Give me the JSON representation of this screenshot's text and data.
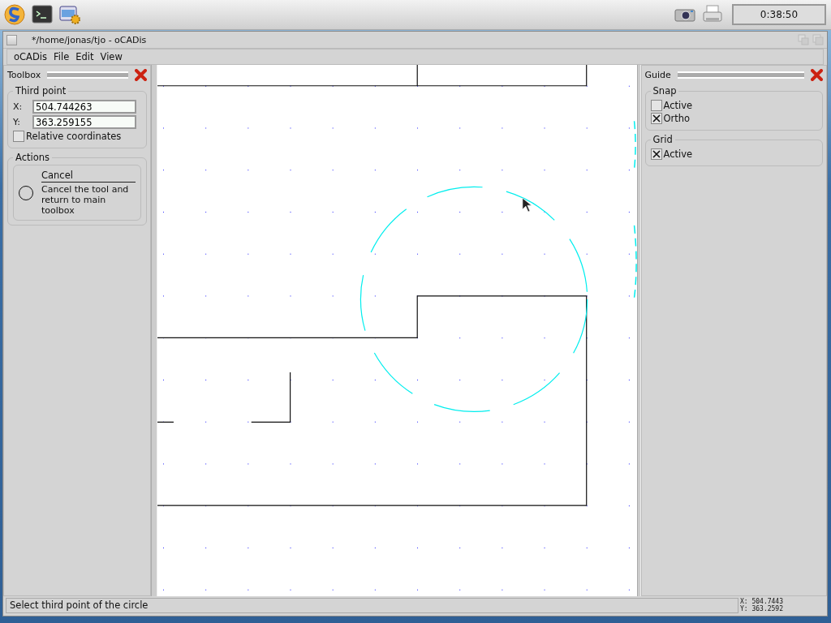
{
  "taskbar": {
    "clock": "0:38:50"
  },
  "window": {
    "title": "*/home/jonas/tjo - oCADis"
  },
  "menu": [
    "oCADis",
    "File",
    "Edit",
    "View"
  ],
  "toolbox": {
    "title": "Toolbox",
    "group": "Third point",
    "fields": [
      {
        "label": "X:",
        "value": "504.744263"
      },
      {
        "label": "Y:",
        "value": "363.259155"
      }
    ],
    "relative": {
      "label": "Relative coordinates",
      "checked": false
    },
    "actions_title": "Actions",
    "actions": [
      {
        "title": "Cancel",
        "description": "Cancel the tool and return to main toolbox"
      }
    ]
  },
  "guide": {
    "title": "Guide",
    "groups": [
      {
        "title": "Snap",
        "options": [
          {
            "label": "Active",
            "checked": false
          },
          {
            "label": "Ortho",
            "checked": true
          }
        ]
      },
      {
        "title": "Grid",
        "options": [
          {
            "label": "Active",
            "checked": true
          }
        ]
      }
    ]
  },
  "status_bar": {
    "message": "Select third point of the circle",
    "x": "X: 504.7443",
    "y": "Y: 363.2592"
  }
}
